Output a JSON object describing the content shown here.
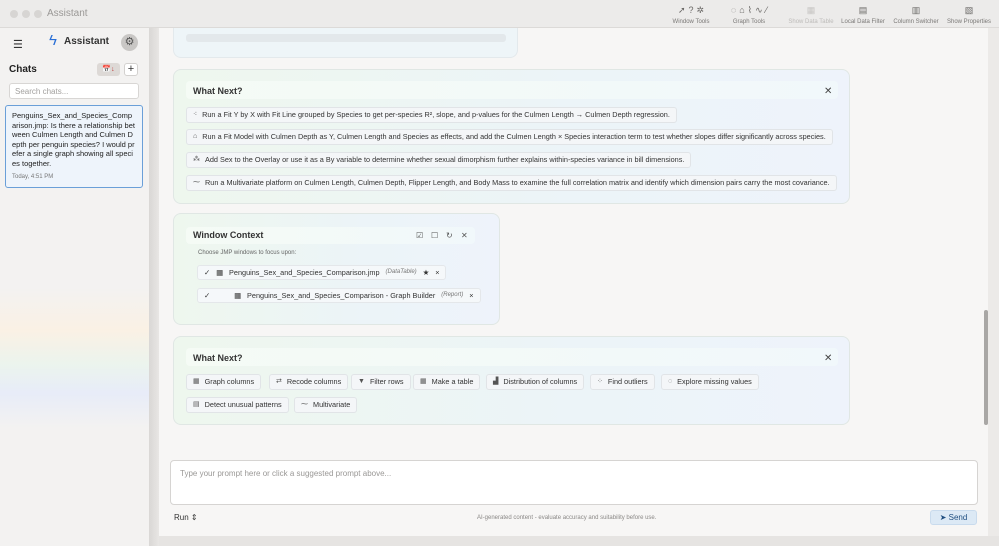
{
  "window": {
    "title": "Assistant"
  },
  "toolbar": {
    "groups": [
      {
        "label": "Window Tools",
        "icons": [
          "cursor-icon",
          "help-icon",
          "crosshair-icon"
        ],
        "glyphs": [
          "➚",
          "?",
          "✲"
        ],
        "disabled": false
      },
      {
        "label": "Graph Tools",
        "icons": [
          "lasso-icon",
          "brush-icon",
          "freehand-icon",
          "line-icon",
          "pen-icon"
        ],
        "glyphs": [
          "◌",
          "⌂",
          "⌇",
          "∿",
          "⁄"
        ],
        "disabled": false
      },
      {
        "label": "Show Data Table",
        "icons": [
          "table-icon"
        ],
        "glyphs": [
          "▦"
        ],
        "disabled": true
      },
      {
        "label": "Local Data Filter",
        "icons": [
          "filter-icon"
        ],
        "glyphs": [
          "▤"
        ],
        "disabled": false
      },
      {
        "label": "Column Switcher",
        "icons": [
          "columns-icon"
        ],
        "glyphs": [
          "▥"
        ],
        "disabled": false
      },
      {
        "label": "Show Properties",
        "icons": [
          "properties-icon"
        ],
        "glyphs": [
          "▧"
        ],
        "disabled": false
      }
    ]
  },
  "sidebar": {
    "brand": "Assistant",
    "chats_title": "Chats",
    "sort_glyph": "📅↓",
    "add_glyph": "+",
    "search_placeholder": "Search chats...",
    "chats": [
      {
        "title": "Penguins_Sex_and_Species_Comparison.jmp: Is there a relationship between Culmen Length and Culmen Depth per penguin species? I would prefer a single graph showing all species together.",
        "time": "Today, 4:51 PM"
      }
    ]
  },
  "what_next_1": {
    "title": "What Next?",
    "suggestions": [
      {
        "icon": "scatter-icon",
        "glyph": "⁖",
        "text": "Run a Fit Y by X with Fit Line grouped by Species to get per-species R², slope, and p-values for the Culmen Length → Culmen Depth regression."
      },
      {
        "icon": "model-icon",
        "glyph": "⌂",
        "text": "Run a Fit Model with Culmen Depth as Y, Culmen Length and Species as effects, and add the Culmen Length × Species interaction term to test whether slopes differ significantly across species."
      },
      {
        "icon": "overlay-icon",
        "glyph": "⁂",
        "text": "Add Sex to the Overlay or use it as a By variable to determine whether sexual dimorphism further explains within-species variance in bill dimensions."
      },
      {
        "icon": "multivariate-icon",
        "glyph": "⁓",
        "text": "Run a Multivariate platform on Culmen Length, Culmen Depth, Flipper Length, and Body Mass to examine the full correlation matrix and identify which dimension pairs carry the most covariance."
      }
    ]
  },
  "window_context": {
    "title": "Window Context",
    "subtitle": "Choose JMP windows to focus upon:",
    "windows": [
      {
        "name": "Penguins_Sex_and_Species_Comparison.jmp",
        "type": "(DataTable)",
        "checked": "✓"
      },
      {
        "name": "Penguins_Sex_and_Species_Comparison - Graph Builder",
        "type": "(Report)",
        "checked": "✓"
      }
    ]
  },
  "what_next_2": {
    "title": "What Next?",
    "chips": [
      {
        "icon": "graph-icon",
        "glyph": "▦",
        "label": "Graph columns"
      },
      {
        "icon": "recode-icon",
        "glyph": "⇄",
        "label": "Recode columns"
      },
      {
        "icon": "filter-icon",
        "glyph": "▼",
        "label": "Filter rows"
      },
      {
        "icon": "table-icon",
        "glyph": "▦",
        "label": "Make a table"
      },
      {
        "icon": "distribution-icon",
        "glyph": "▟",
        "label": "Distribution of columns"
      },
      {
        "icon": "outliers-icon",
        "glyph": "⁘",
        "label": "Find outliers"
      },
      {
        "icon": "missing-icon",
        "glyph": "◌",
        "label": "Explore missing values"
      },
      {
        "icon": "patterns-icon",
        "glyph": "▤",
        "label": "Detect unusual patterns"
      },
      {
        "icon": "multivariate-icon",
        "glyph": "⁓",
        "label": "Multivariate"
      }
    ]
  },
  "prompt": {
    "placeholder": "Type your prompt here or click a suggested prompt above...",
    "run_label": "Run",
    "disclaimer": "AI-generated content - evaluate accuracy and suitability before use.",
    "send_label": "Send"
  }
}
